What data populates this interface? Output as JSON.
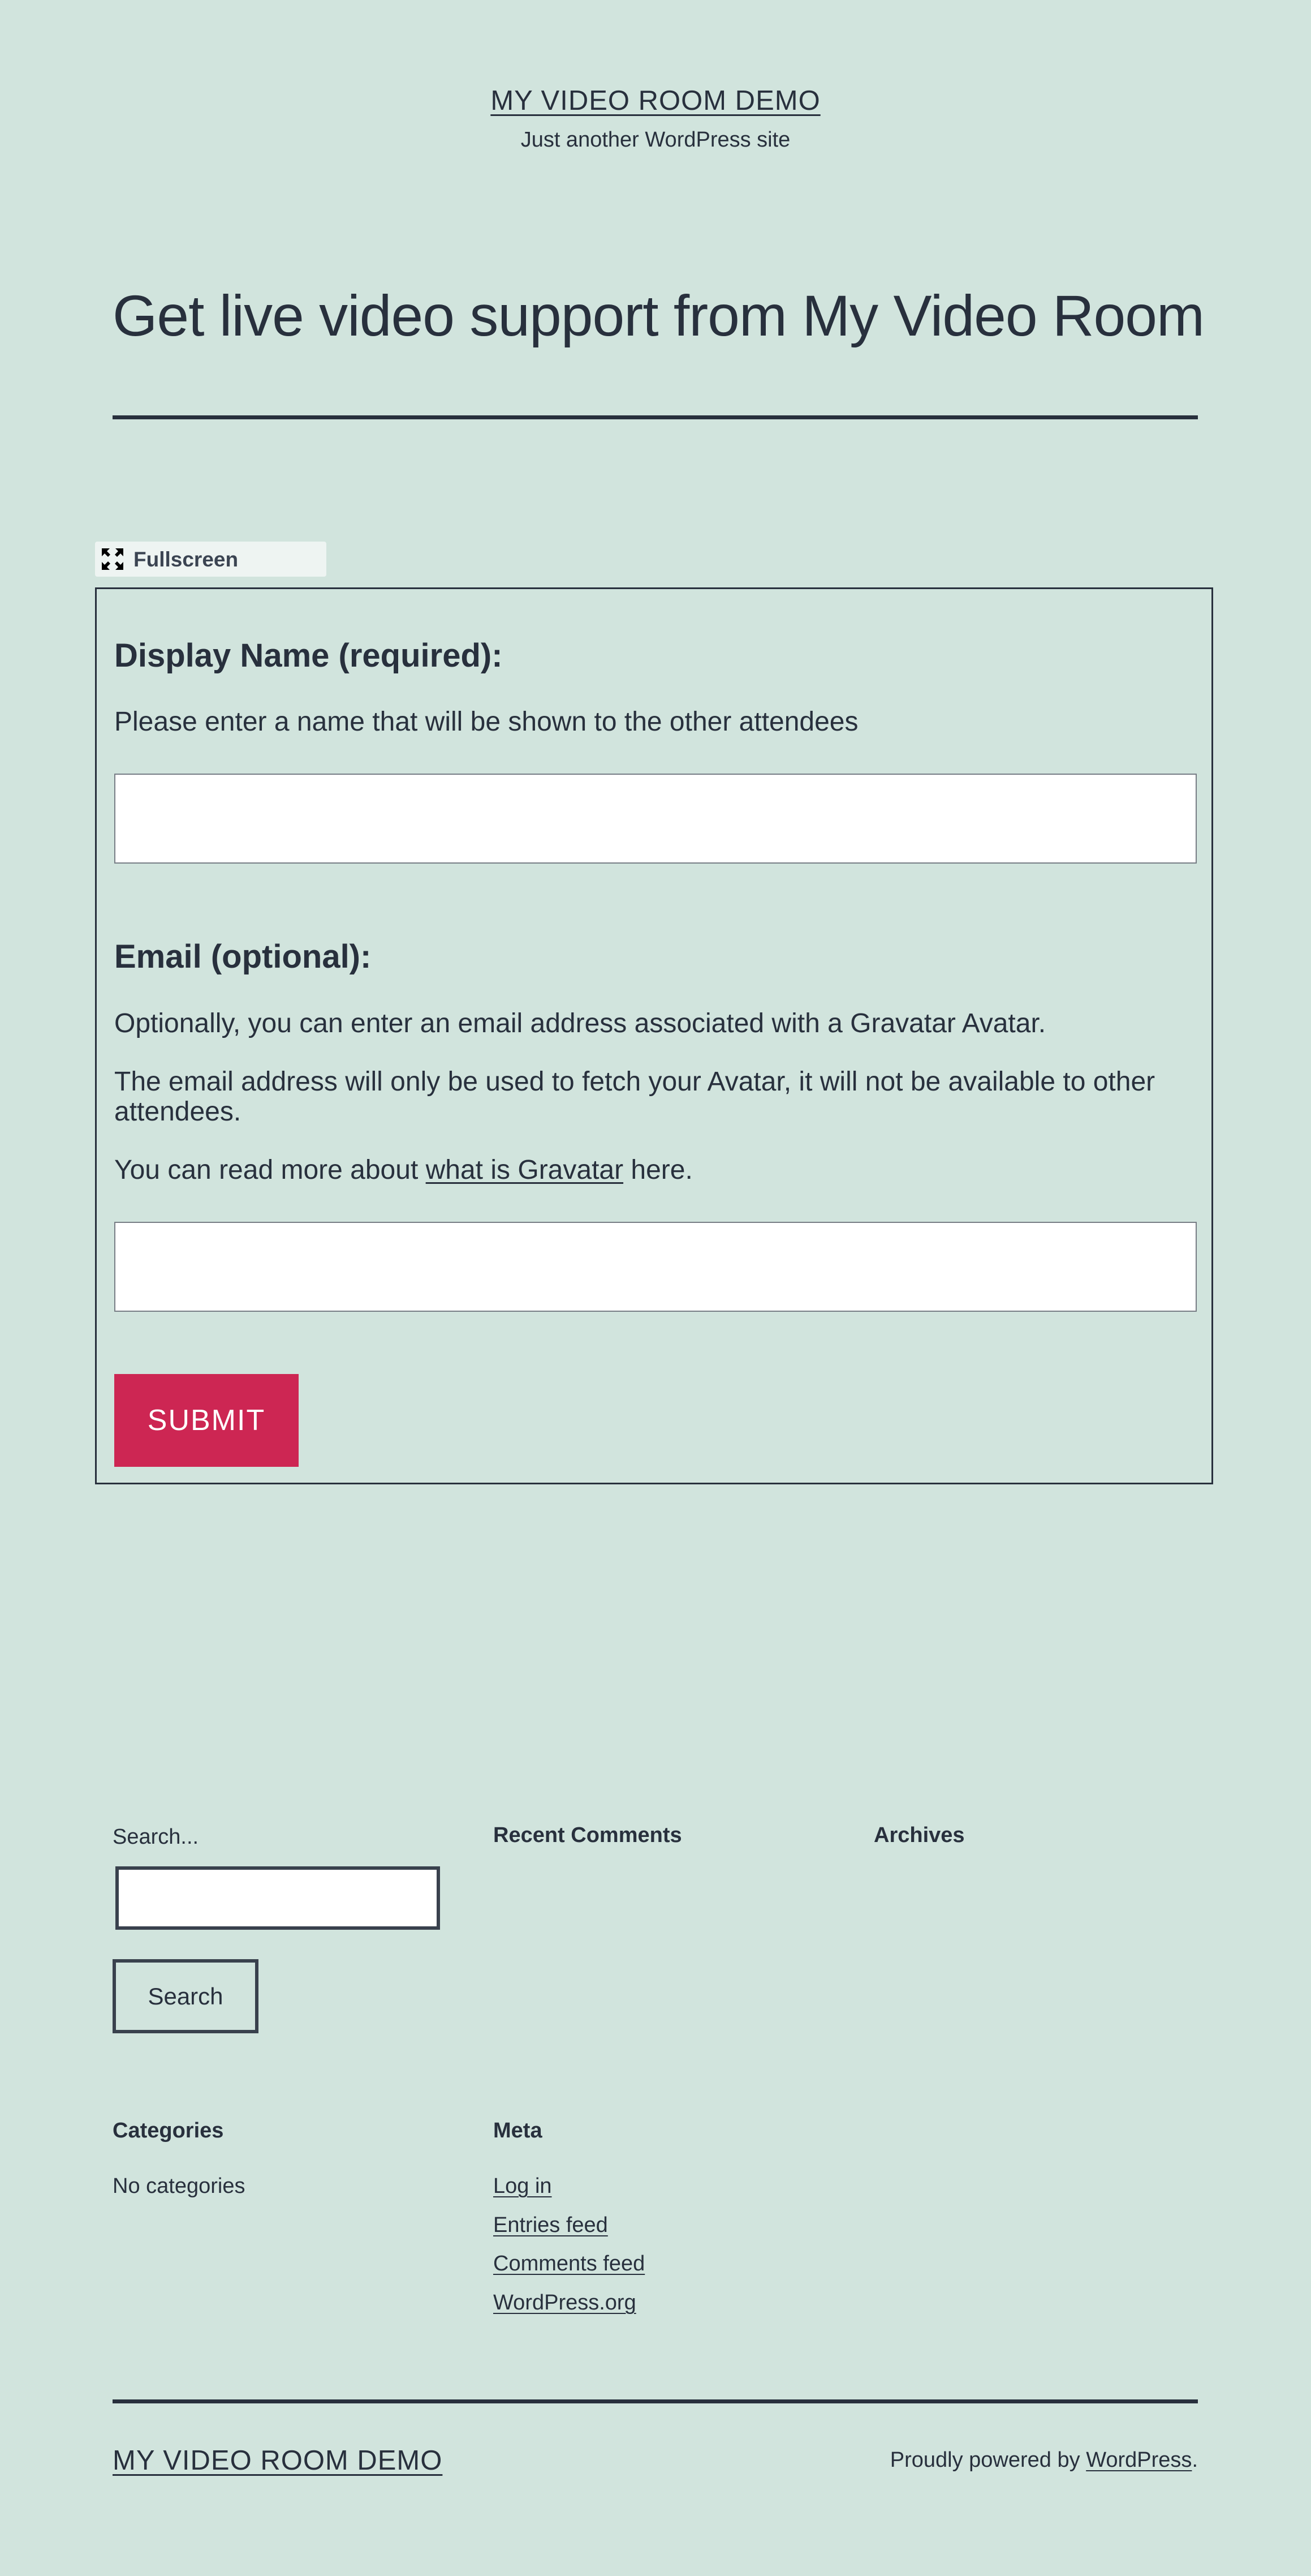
{
  "header": {
    "site_title": "MY VIDEO ROOM DEMO",
    "site_description": "Just another WordPress site"
  },
  "page": {
    "title": "Get live video support from My Video Room"
  },
  "video_room": {
    "fullscreen_label": "Fullscreen",
    "fullscreen_icon": "expand-icon",
    "display_name_heading": "Display Name (required):",
    "display_name_help": "Please enter a name that will be shown to the other attendees",
    "display_name_value": "",
    "email_heading": "Email (optional):",
    "email_help_1": "Optionally, you can enter an email address associated with a Gravatar Avatar.",
    "email_help_2_line1": "The email address will only be used to fetch your Avatar, it will not be available to other",
    "email_help_2_line2": "attendees.",
    "email_help_3_before": "You can read more about ",
    "email_help_3_link": "what is Gravatar",
    "email_help_3_after": " here.",
    "email_value": "",
    "submit_label": "SUBMIT",
    "submit_color": "#cd2653"
  },
  "widgets": {
    "search_label": "Search...",
    "search_value": "",
    "search_button": "Search",
    "recent_comments_title": "Recent Comments",
    "archives_title": "Archives",
    "categories_title": "Categories",
    "categories_empty": "No categories",
    "meta_title": "Meta",
    "meta_links": [
      "Log in",
      "Entries feed",
      "Comments feed",
      "WordPress.org"
    ]
  },
  "footer": {
    "site_title": "MY VIDEO ROOM DEMO",
    "powered_prefix": "Proudly powered by ",
    "powered_link": "WordPress",
    "powered_suffix": "."
  },
  "colors": {
    "background": "#d1e4dd",
    "text": "#28303d",
    "accent": "#cd2653"
  }
}
